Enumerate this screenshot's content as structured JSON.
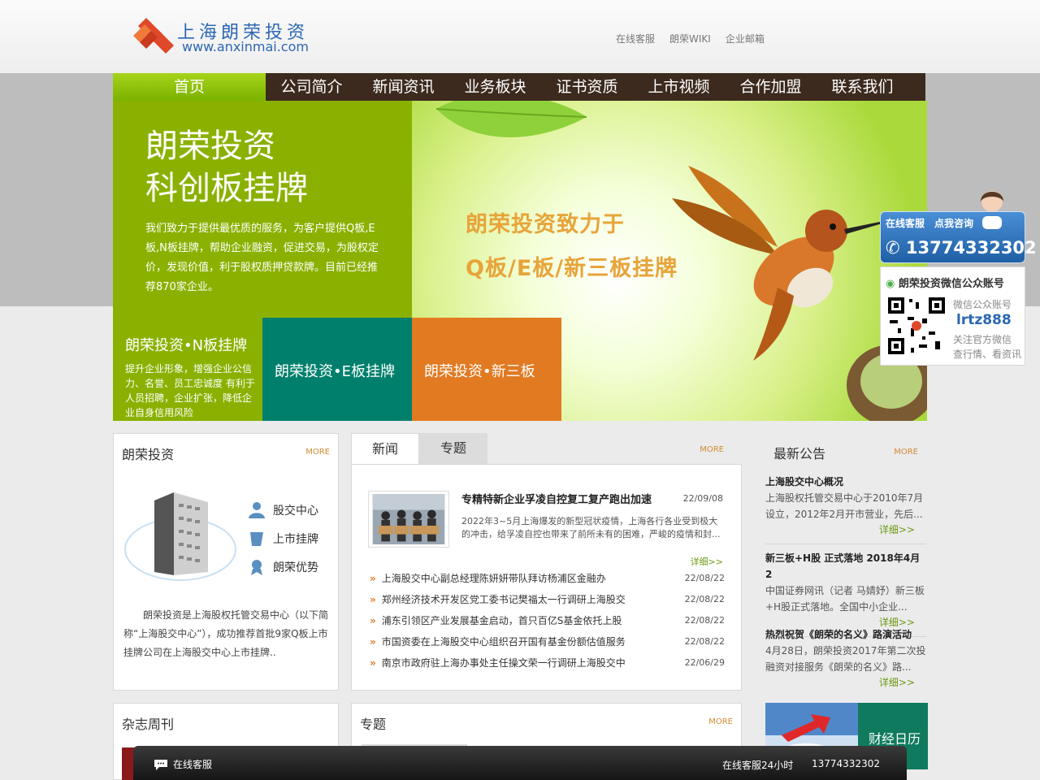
{
  "header": {
    "logo_cn": "上海朗荣投资",
    "logo_en": "www.anxinmai.com",
    "links": [
      "在线客服",
      "朗荣WIKI",
      "企业邮箱"
    ]
  },
  "nav": {
    "home": "首页",
    "items": [
      "公司简介",
      "新闻资讯",
      "业务板块",
      "证书资质",
      "上市视频",
      "合作加盟",
      "联系我们"
    ]
  },
  "hero": {
    "title_line1": "朗荣投资",
    "title_line2": "科创板挂牌",
    "desc": "我们致力于提供最优质的服务，为客户提供Q板,E板,N板挂牌，帮助企业融资，促进交易，为股权定价，发现价值，利于股权质押贷款牌。目前已经推荐870家企业。",
    "slogan_line1": "朗荣投资致力于",
    "slogan_line2": "Q板/E板/新三板挂牌",
    "tiles": [
      {
        "title": "朗荣投资•N板挂牌",
        "desc": "提升企业形象，增强企业公信力、名誉、员工忠诚度 有利于人员招聘，企业扩张，降低企业自身信用风险"
      },
      {
        "title": "朗荣投资•E板挂牌"
      },
      {
        "title": "朗荣投资•新三板"
      }
    ]
  },
  "side": {
    "consult_tag": "在线客服　点我咨询",
    "phone": "13774332302",
    "wx_title": "朗荣投资微信公众账号",
    "wx_label": "微信公众账号",
    "wx_id": "lrtz888",
    "wx_note1": "关注官方微信",
    "wx_note2": "查行情、看资讯"
  },
  "intro": {
    "title": "朗荣投资",
    "more": "MORE",
    "links": [
      "股交中心",
      "上市挂牌",
      "朗荣优势"
    ],
    "text": "朗荣投资是上海股权托管交易中心（以下简称“上海股交中心”），成功推荐首批9家Q板上市挂牌公司在上海股交中心上市挂牌.."
  },
  "news": {
    "tab_active": "新闻",
    "tab_other": "专题",
    "more": "MORE",
    "featured": {
      "title": "专精特新企业孚凌自控复工复产跑出加速",
      "date": "22/09/08",
      "desc": "2022年3~5月上海爆发的新型冠状疫情，上海各行各业受到极大的冲击，给孚凌自控也带来了前所未有的困难，严峻的疫情和封...",
      "more": "详细>>"
    },
    "items": [
      {
        "title": "上海股交中心副总经理陈妍妍带队拜访杨浦区金融办",
        "date": "22/08/22"
      },
      {
        "title": "郑州经济技术开发区党工委书记樊福太一行调研上海股交",
        "date": "22/08/22"
      },
      {
        "title": "浦东引领区产业发展基金启动，首只百亿S基金依托上股",
        "date": "22/08/22"
      },
      {
        "title": "市国资委在上海股交中心组织召开国有基金份额估值服务",
        "date": "22/08/22"
      },
      {
        "title": "南京市政府驻上海办事处主任操文荣一行调研上海股交中",
        "date": "22/06/29"
      }
    ]
  },
  "notice": {
    "title": "最新公告",
    "more": "MORE",
    "items": [
      {
        "title": "上海股交中心概况",
        "desc": "上海股权托管交易中心于2010年7月设立，2012年2月开市营业，先后...",
        "more": "详细>>"
      },
      {
        "title": "新三板+H股 正式落地 2018年4月2",
        "desc": "中国证券网讯（记者 马婧妤）新三板+H股正式落地。全国中小企业...",
        "more": "详细>>"
      },
      {
        "title": "热烈祝贺《朗荣的名义》路演活动",
        "desc": "4月28日，朗荣投资2017年第二次投融资对接服务《朗荣的名义》路...",
        "more": "详细>>"
      }
    ]
  },
  "magazine": {
    "title": "杂志周刊"
  },
  "topic": {
    "title": "专题",
    "more": "MORE"
  },
  "calendar": {
    "label": "财经日历"
  },
  "bottombar": {
    "chat": "在线客服",
    "hours": "在线客服24小时",
    "phone": "13774332302"
  },
  "colors": {
    "nav_bg": "#3c2a1e",
    "green": "#8ab100",
    "teal": "#00806c",
    "orange": "#e27a22",
    "accent_blue": "#2b67b3"
  }
}
